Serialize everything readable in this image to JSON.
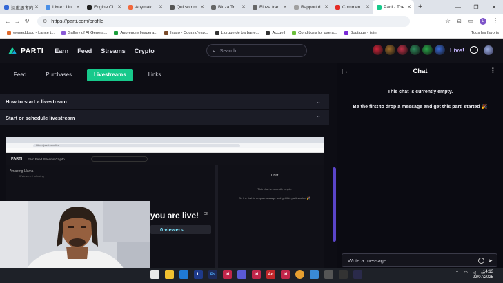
{
  "browser": {
    "tabs": [
      {
        "label": "深度思考的",
        "color": "#3367d6",
        "active": false
      },
      {
        "label": "Livre : Un",
        "color": "#4a8fe7",
        "active": false
      },
      {
        "label": "Engine Cl",
        "color": "#222222",
        "active": false
      },
      {
        "label": "Anymatc",
        "color": "#f2683c",
        "active": false
      },
      {
        "label": "Qui somm",
        "color": "#555555",
        "active": false
      },
      {
        "label": "Bluza Tr",
        "color": "#666666",
        "active": false
      },
      {
        "label": "Bluza trad",
        "color": "#666666",
        "active": false
      },
      {
        "label": "Rapport d",
        "color": "#a0a0a0",
        "active": false
      },
      {
        "label": "Commen",
        "color": "#e52d27",
        "active": false
      },
      {
        "label": "Parti - The",
        "color": "#17c98b",
        "active": true
      }
    ],
    "url": "https://parti.com/profile",
    "bookmarks": [
      {
        "label": "wweeddooo - Lance t...",
        "color": "#e06a2c"
      },
      {
        "label": "Gallery of AI Genera...",
        "color": "#8a5ad6"
      },
      {
        "label": "Apprendre l'espera...",
        "color": "#1a9e3a"
      },
      {
        "label": "Ikuso - Cours d'esp...",
        "color": "#7a4b2a"
      },
      {
        "label": "L'orgue de barbarie...",
        "color": "#333333"
      },
      {
        "label": "Accueil",
        "color": "#333333"
      },
      {
        "label": "Conditions for use a...",
        "color": "#6bbf3a"
      },
      {
        "label": "Boutique - isiin",
        "color": "#7a2ad6"
      }
    ],
    "bookmarks_right": "Tous les favoris"
  },
  "site": {
    "logo": "PARTI",
    "nav": [
      "Earn",
      "Feed",
      "Streams",
      "Crypto"
    ],
    "search_placeholder": "Search",
    "live_label": "Live!",
    "header_badges": [
      "#d0243a",
      "#9a6a2a",
      "#c03048",
      "#2d8a5a",
      "#2aa84a",
      "#3a6ad6"
    ]
  },
  "profile": {
    "subtabs": [
      "Feed",
      "Purchases",
      "Livestreams",
      "Links"
    ],
    "active_subtab": "Livestreams",
    "accordion": [
      {
        "title": "How to start a livestream",
        "open": false
      },
      {
        "title": "Start or schedule livestream",
        "open": true
      }
    ]
  },
  "nested_capture": {
    "url": "https://parti.com/live",
    "logo": "PARTI",
    "nav": "Earn   Feed   Streams   Crypto",
    "channel_name": "Amazing Llama",
    "channel_sub": "0 Viewers  0 following",
    "chat_title": "Chat",
    "chat_empty": "This chat is currently empty.",
    "chat_first": "Be the first to drop a message and get this parti started 🎉",
    "live_text": "you are live!",
    "viewers": "0 viewers",
    "off_label": "Off"
  },
  "chat": {
    "title": "Chat",
    "empty_line": "This chat is currently empty.",
    "first_line": "Be the first to drop a message and get this parti started 🎉",
    "input_placeholder": "Write a message..."
  },
  "taskbar": {
    "time": "14:13",
    "date": "22/07/2025"
  }
}
